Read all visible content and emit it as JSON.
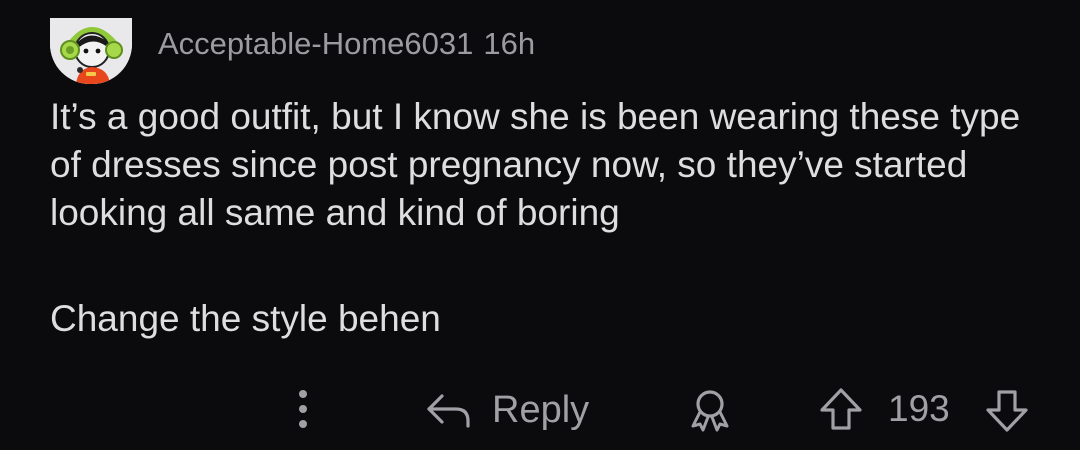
{
  "comment": {
    "author": "Acceptable-Home6031",
    "time": "16h",
    "paragraphs": [
      "It’s a good outfit, but I know she is been wearing these type of dresses since post pregnancy now, so they’ve started looking all same and kind of boring",
      "Change the style behen"
    ]
  },
  "actions": {
    "reply_label": "Reply",
    "score": "193",
    "icons": {
      "more": "more-vertical-icon",
      "reply": "reply-arrow-icon",
      "award": "award-icon",
      "upvote": "upvote-arrow-icon",
      "downvote": "downvote-arrow-icon"
    }
  },
  "colors": {
    "background": "#0b0b0d",
    "text": "#dedee0",
    "meta": "#9b9ba0",
    "icon": "#a0a0a5"
  }
}
